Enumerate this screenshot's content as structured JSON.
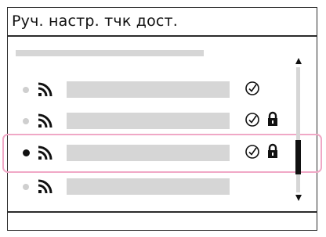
{
  "screen": {
    "title": "Руч. настр. тчк дост."
  },
  "list": {
    "selected_index": 2,
    "items": [
      {
        "signal_icon": "wifi-icon",
        "verified": true,
        "locked": false,
        "selected": false
      },
      {
        "signal_icon": "wifi-icon",
        "verified": true,
        "locked": true,
        "selected": false
      },
      {
        "signal_icon": "wifi-icon",
        "verified": true,
        "locked": true,
        "selected": true
      },
      {
        "signal_icon": "wifi-icon",
        "verified": false,
        "locked": false,
        "selected": false
      }
    ]
  },
  "colors": {
    "highlight": "#f0a8c6",
    "placeholder": "#d6d6d6",
    "foreground": "#111111"
  }
}
